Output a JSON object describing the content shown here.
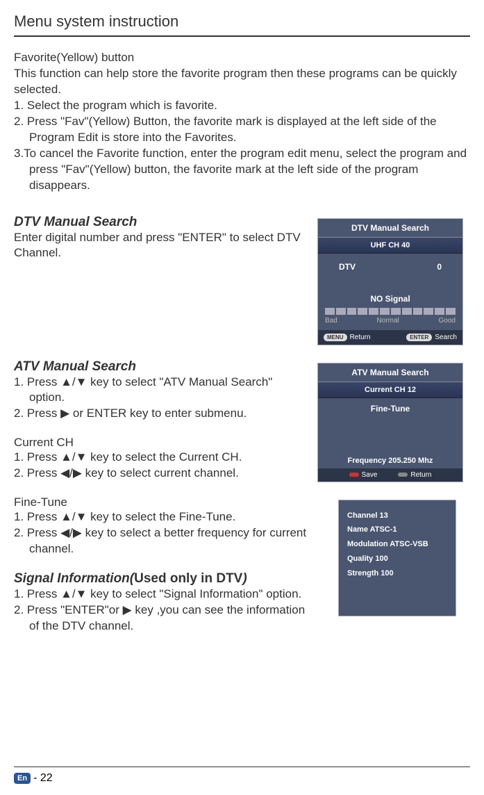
{
  "page": {
    "header": "Menu system instruction",
    "footer_lang": "En",
    "footer_page": "- 22"
  },
  "favorite": {
    "title": "Favorite(Yellow) button",
    "intro": "This function can help store the favorite program then these programs can be quickly selected.",
    "step1": "1. Select the program which is favorite.",
    "step2": "2. Press \"Fav\"(Yellow) Button, the favorite mark is displayed at the left side of the Program Edit is store into the Favorites.",
    "step3": "3.To cancel the Favorite function, enter the program edit menu, select the program and press \"Fav\"(Yellow) button, the favorite mark at the left side of the program disappears."
  },
  "dtv": {
    "heading": "DTV Manual Search",
    "text": "Enter digital number and press \"ENTER\" to select DTV Channel.",
    "panel": {
      "title": "DTV Manual Search",
      "band": "UHF CH 40",
      "label_dtv": "DTV",
      "value_dtv": "0",
      "nosignal": "NO Signal",
      "bad": "Bad",
      "normal": "Normal",
      "good": "Good",
      "btn_menu": "MENU",
      "return": "Return",
      "btn_enter": "ENTER",
      "search": "Search"
    }
  },
  "atv": {
    "heading": "ATV Manual Search",
    "step1": "1. Press ▲/▼ key to select \"ATV Manual Search\" option.",
    "step2": "2. Press ▶ or ENTER key to enter submenu.",
    "current_heading": "Current CH",
    "current_step1": "1. Press ▲/▼ key to select the Current CH.",
    "current_step2": "2. Press ◀/▶ key to select current channel.",
    "fine_heading": "Fine-Tune",
    "fine_step1": "1. Press ▲/▼ key to select the Fine-Tune.",
    "fine_step2": "2. Press ◀/▶ key to select a better frequency for current channel.",
    "panel": {
      "title": "ATV Manual Search",
      "band": "Current CH 12",
      "finetune": "Fine-Tune",
      "frequency": "Frequency 205.250 Mhz",
      "save": "Save",
      "return": "Return"
    }
  },
  "siginfo": {
    "heading_italic": "Signal Information(",
    "heading_plain": "Used only in DTV",
    "heading_close": ")",
    "step1": "1. Press ▲/▼ key to select \"Signal Information\" option.",
    "step2": "2. Press \"ENTER\"or  ▶ key ,you can see the information of  the DTV channel.",
    "panel": {
      "channel": "Channel 13",
      "name": "Name ATSC-1",
      "modulation": "Modulation ATSC-VSB",
      "quality": "Quality 100",
      "strength": "Strength 100"
    }
  }
}
